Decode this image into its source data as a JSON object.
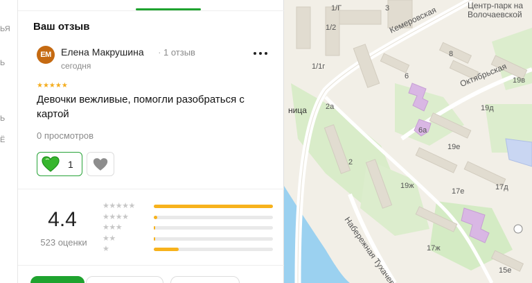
{
  "left_strip": {
    "fragments": [
      "ЬЯ",
      "Ь",
      "Ь",
      "Ё"
    ]
  },
  "review": {
    "section_title": "Ваш отзыв",
    "avatar_initials": "ЕМ",
    "avatar_color": "#c56a12",
    "author_name": "Елена Макрушина",
    "author_reviews": "1 отзыв",
    "date": "сегодня",
    "stars": "★★★★★",
    "rating_value": 5,
    "text": "Девочки вежливые, помогли разобраться с картой",
    "views": "0 просмотров",
    "like_count": "1",
    "like_icon": "green-heart-icon",
    "dislike_icon": "grey-heart-icon",
    "more_icon": "more-dots-icon"
  },
  "summary": {
    "average": "4.4",
    "count_label": "523 оценки",
    "histogram": [
      {
        "stars": "★★★★★",
        "fraction": 1.0
      },
      {
        "stars": "★★★★",
        "fraction": 0.03
      },
      {
        "stars": "★★★",
        "fraction": 0.01
      },
      {
        "stars": "★★",
        "fraction": 0.01
      },
      {
        "stars": "★",
        "fraction": 0.21
      }
    ]
  },
  "colors": {
    "accent": "#1fa32f",
    "star": "#f4ad1f",
    "bar_fill": "#f7b21c"
  },
  "map": {
    "labels": {
      "park": "Центр-парк на\nВолочаевской",
      "street1": "Кемеровская",
      "street2": "Октябрьская",
      "street3": "Набережная Тухачев",
      "station": "ница",
      "h3": "3",
      "h12": "1/2",
      "h1g": "1/Г",
      "h1ig": "1/1г",
      "h2a": "2а",
      "h2": "2",
      "h6": "6",
      "h6a": "6а",
      "h8": "8",
      "h19v": "19в",
      "h19d": "19д",
      "h19e": "19е",
      "h19zh": "19ж",
      "h17e": "17е",
      "h17d": "17д",
      "h17zh": "17ж",
      "h15e": "15е"
    }
  }
}
